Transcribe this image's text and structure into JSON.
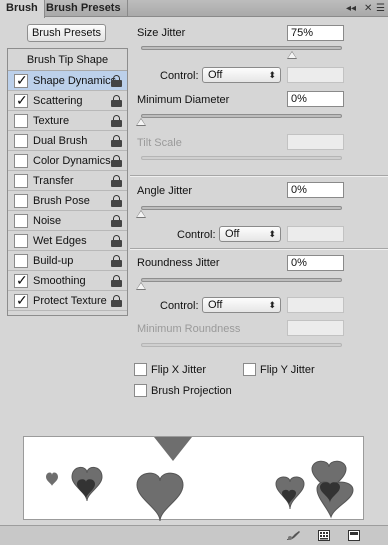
{
  "tabs": [
    {
      "label": "Brush",
      "active": true
    },
    {
      "label": "Brush Presets",
      "active": false
    }
  ],
  "panel_controls": {
    "collapse": "◂◂",
    "close": "✕",
    "menu": "☰"
  },
  "brush_presets_button": "Brush Presets",
  "left_list": {
    "header": "Brush Tip Shape",
    "items": [
      {
        "label": "Shape Dynamics",
        "checked": "✓",
        "selected": true,
        "locked": true
      },
      {
        "label": "Scattering",
        "checked": "✓",
        "selected": false,
        "locked": true
      },
      {
        "label": "Texture",
        "checked": "",
        "selected": false,
        "locked": true
      },
      {
        "label": "Dual Brush",
        "checked": "",
        "selected": false,
        "locked": true
      },
      {
        "label": "Color Dynamics",
        "checked": "",
        "selected": false,
        "locked": true
      },
      {
        "label": "Transfer",
        "checked": "",
        "selected": false,
        "locked": true
      },
      {
        "label": "Brush Pose",
        "checked": "",
        "selected": false,
        "locked": true
      },
      {
        "label": "Noise",
        "checked": "",
        "selected": false,
        "locked": true
      },
      {
        "label": "Wet Edges",
        "checked": "",
        "selected": false,
        "locked": true
      },
      {
        "label": "Build-up",
        "checked": "",
        "selected": false,
        "locked": true
      },
      {
        "label": "Smoothing",
        "checked": "✓",
        "selected": false,
        "locked": true
      },
      {
        "label": "Protect Texture",
        "checked": "✓",
        "selected": false,
        "locked": true
      }
    ]
  },
  "size_jitter": {
    "label": "Size Jitter",
    "value": "75%",
    "slider_value": 0.75,
    "control_label": "Control:",
    "control_value": "Off"
  },
  "minimum_diameter": {
    "label": "Minimum Diameter",
    "value": "0%",
    "slider_value": 0
  },
  "tilt_scale": {
    "label": "Tilt Scale",
    "value": ""
  },
  "angle_jitter": {
    "label": "Angle Jitter",
    "value": "0%",
    "slider_value": 0,
    "control_label": "Control:",
    "control_value": "Off"
  },
  "roundness_jitter": {
    "label": "Roundness Jitter",
    "value": "0%",
    "slider_value": 0,
    "control_label": "Control:",
    "control_value": "Off"
  },
  "minimum_roundness": {
    "label": "Minimum Roundness",
    "value": ""
  },
  "options": {
    "flip_x": {
      "label": "Flip X Jitter",
      "checked": false
    },
    "flip_y": {
      "label": "Flip Y Jitter",
      "checked": false
    },
    "brush_projection": {
      "label": "Brush Projection",
      "checked": false
    }
  },
  "icons": {
    "toggle_bristle": "brush-preview-icon",
    "grid": "grid-icon",
    "new_preset": "new-preset-icon"
  },
  "colors": {
    "selected_row": "#bcd0ea",
    "heart_fill": "#6e6e6e",
    "heart_dark": "#333333"
  }
}
